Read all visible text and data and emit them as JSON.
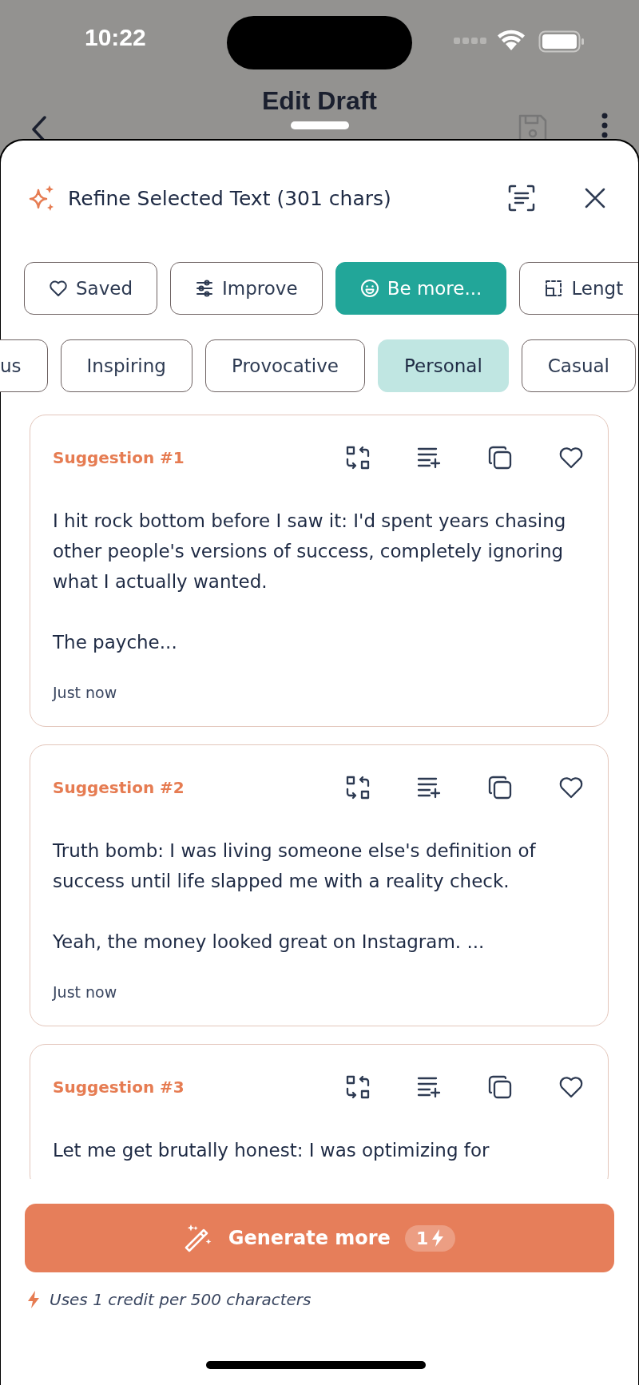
{
  "status_bar": {
    "time": "10:22"
  },
  "nav": {
    "title": "Edit Draft"
  },
  "sheet": {
    "title": "Refine Selected Text (301 chars)"
  },
  "modes": [
    {
      "label": "Saved",
      "kind": "heart",
      "selected": false
    },
    {
      "label": "Improve",
      "kind": "sliders",
      "selected": false
    },
    {
      "label": "Be more...",
      "kind": "smile",
      "selected": true
    },
    {
      "label": "Lengt",
      "kind": "resize",
      "selected": false
    }
  ],
  "tones": [
    {
      "label": "us",
      "selected": false
    },
    {
      "label": "Inspiring",
      "selected": false
    },
    {
      "label": "Provocative",
      "selected": false
    },
    {
      "label": "Personal",
      "selected": true
    },
    {
      "label": "Casual",
      "selected": false
    }
  ],
  "suggestions": [
    {
      "label": "Suggestion #1",
      "text": "I hit rock bottom before I saw it: I'd spent years chasing other people's versions of success, completely ignoring what I actually wanted.\n\nThe payche...",
      "time": "Just now"
    },
    {
      "label": "Suggestion #2",
      "text": "Truth bomb: I was living someone else's definition of success until life slapped me with a reality check.\n\nYeah, the money looked great on Instagram. ...",
      "time": "Just now"
    },
    {
      "label": "Suggestion #3",
      "text": "Let me get brutally honest: I was optimizing for"
    }
  ],
  "generate_button": {
    "label": "Generate more",
    "cost": "1"
  },
  "footnote": "Uses 1 credit per 500 characters"
}
